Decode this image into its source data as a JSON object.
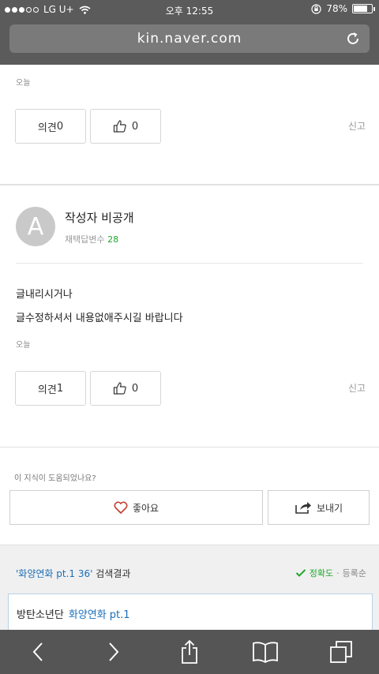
{
  "status": {
    "carrier": "LG U+",
    "time": "오후 12:55",
    "battery": "78%",
    "battery_level": 0.78
  },
  "browser": {
    "url": "kin.naver.com"
  },
  "answer1": {
    "date": "오늘",
    "comment_label": "의견",
    "comment_count": "0",
    "like_count": "0",
    "report": "신고"
  },
  "answer2": {
    "author": "작성자 비공개",
    "meta_label": "채택답변수",
    "meta_value": "28",
    "avatar_letter": "A",
    "line1": "글내리시거나",
    "line2": "글수정하셔서 내용없애주시길 바랍니다",
    "date": "오늘",
    "comment_label": "의견",
    "comment_count": "1",
    "like_count": "0",
    "report": "신고"
  },
  "feedback": {
    "question": "이 지식이 도움되었나요?",
    "like_label": "좋아요",
    "share_label": "보내기"
  },
  "search": {
    "query_text": "'화양연화 pt.1 36'",
    "suffix": " 검색결과",
    "accuracy": "정확도",
    "sep": "·",
    "recent": "등록순",
    "card_prefix": "방탄소년단",
    "card_highlight": "화양연화 pt.1"
  },
  "colors": {
    "accent_green": "#1fa82b",
    "link_blue": "#1b6fb8",
    "heart_red": "#c0392b"
  }
}
